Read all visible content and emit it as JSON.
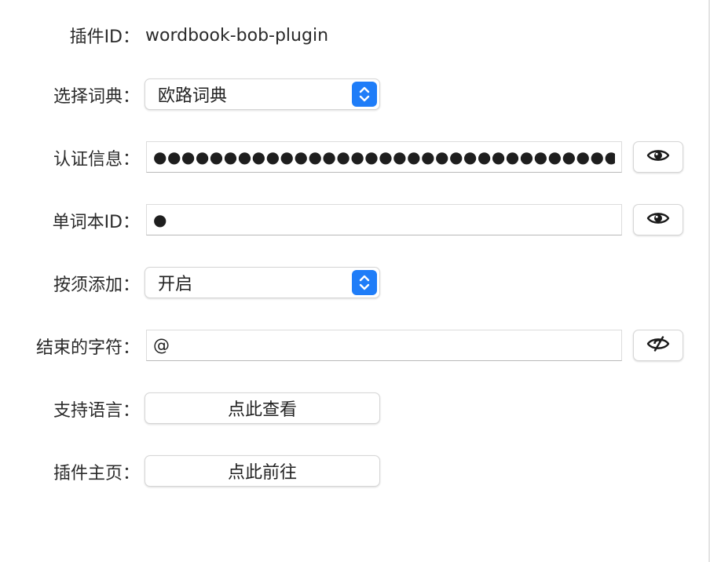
{
  "plugin_id": {
    "label": "插件ID：",
    "value": "wordbook-bob-plugin"
  },
  "dictionary": {
    "label": "选择词典：",
    "value": "欧路词典"
  },
  "auth": {
    "label": "认证信息：",
    "value": "●●●●●●●●●●●●●●●●●●●●●●●●●●●●●●●●●●●●●●●●●",
    "reveal_icon": "eye-icon"
  },
  "wordbook_id": {
    "label": "单词本ID：",
    "value": "●",
    "reveal_icon": "eye-icon"
  },
  "add_on_demand": {
    "label": "按须添加：",
    "value": "开启"
  },
  "end_char": {
    "label": "结束的字符：",
    "value": "@",
    "reveal_icon": "eye-slash-icon"
  },
  "languages": {
    "label": "支持语言：",
    "button": "点此查看"
  },
  "homepage": {
    "label": "插件主页：",
    "button": "点此前往"
  },
  "colors": {
    "accent": "#1f7df8",
    "text": "#262626",
    "background": "#ffffff"
  }
}
